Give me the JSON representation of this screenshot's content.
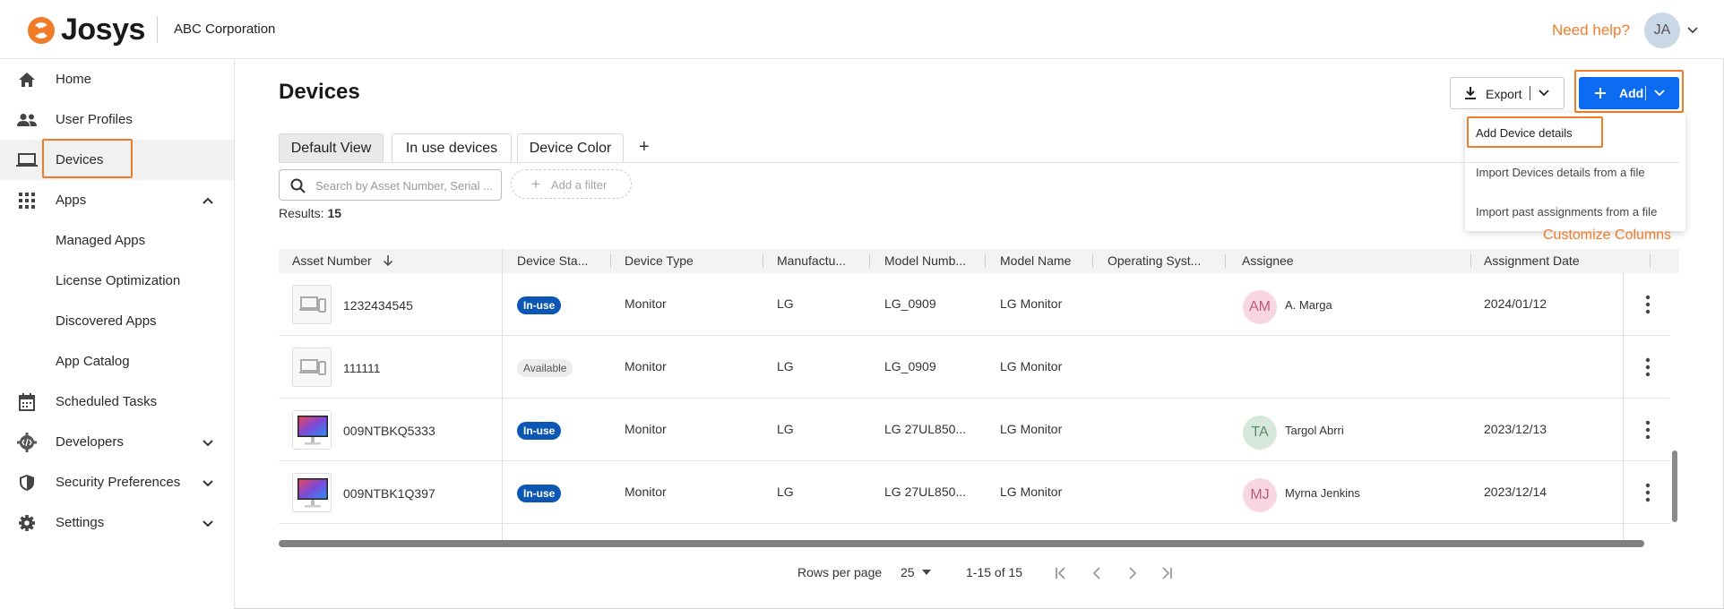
{
  "header": {
    "brand": "Josys",
    "org": "ABC Corporation",
    "help": "Need help?",
    "user_initials": "JA",
    "accent_color": "#f07c2a"
  },
  "sidebar": {
    "items": [
      {
        "label": "Home",
        "icon": "home-icon"
      },
      {
        "label": "User Profiles",
        "icon": "users-icon"
      },
      {
        "label": "Devices",
        "icon": "laptop-icon",
        "active": true
      },
      {
        "label": "Apps",
        "icon": "apps-grid-icon",
        "expanded": true
      },
      {
        "label": "Managed Apps",
        "sub": true
      },
      {
        "label": "License Optimization",
        "sub": true
      },
      {
        "label": "Discovered Apps",
        "sub": true
      },
      {
        "label": "App Catalog",
        "sub": true
      },
      {
        "label": "Scheduled Tasks",
        "icon": "calendar-icon"
      },
      {
        "label": "Developers",
        "icon": "code-gear-icon",
        "expanded": false
      },
      {
        "label": "Security Preferences",
        "icon": "shield-icon",
        "expanded": false
      },
      {
        "label": "Settings",
        "icon": "gear-icon",
        "expanded": false
      }
    ]
  },
  "main": {
    "title": "Devices",
    "export_label": "Export",
    "add_label": "Add",
    "add_menu": [
      "Add Device details",
      "Import Devices details from a file",
      "Import past assignments from a file"
    ],
    "tabs": [
      "Default View",
      "In use devices",
      "Device Color"
    ],
    "tab_add": "+",
    "search_placeholder": "Search by Asset Number, Serial ...",
    "add_filter": "Add a filter",
    "results_label": "Results:",
    "results_count": "15",
    "customize_columns": "Customize Columns"
  },
  "table": {
    "columns": [
      "Asset Number",
      "Device Sta...",
      "Device Type",
      "Manufactu...",
      "Model Numb...",
      "Model Name",
      "Operating Syst...",
      "Assignee",
      "Assignment Date"
    ],
    "rows": [
      {
        "asset": "1232434545",
        "status": "In-use",
        "type": "Monitor",
        "manufacturer": "LG",
        "model_number": "LG_0909",
        "model_name": "LG Monitor",
        "os": "",
        "assignee_initials": "AM",
        "assignee": "A. Marga",
        "date": "2024/01/12",
        "thumb": "placeholder"
      },
      {
        "asset": "111111",
        "status": "Available",
        "type": "Monitor",
        "manufacturer": "LG",
        "model_number": "LG_0909",
        "model_name": "LG Monitor",
        "os": "",
        "assignee_initials": "",
        "assignee": "",
        "date": "",
        "thumb": "placeholder"
      },
      {
        "asset": "009NTBKQ5333",
        "status": "In-use",
        "type": "Monitor",
        "manufacturer": "LG",
        "model_number": "LG 27UL850...",
        "model_name": "LG Monitor",
        "os": "",
        "assignee_initials": "TA",
        "assignee": "Targol Abrri",
        "date": "2023/12/13",
        "thumb": "monitor"
      },
      {
        "asset": "009NTBK1Q397",
        "status": "In-use",
        "type": "Monitor",
        "manufacturer": "LG",
        "model_number": "LG 27UL850...",
        "model_name": "LG Monitor",
        "os": "",
        "assignee_initials": "MJ",
        "assignee": "Myrna Jenkins",
        "date": "2023/12/14",
        "thumb": "monitor"
      }
    ]
  },
  "pagination": {
    "rows_per_page_label": "Rows per page",
    "rows_per_page": "25",
    "range": "1-15 of 15"
  }
}
